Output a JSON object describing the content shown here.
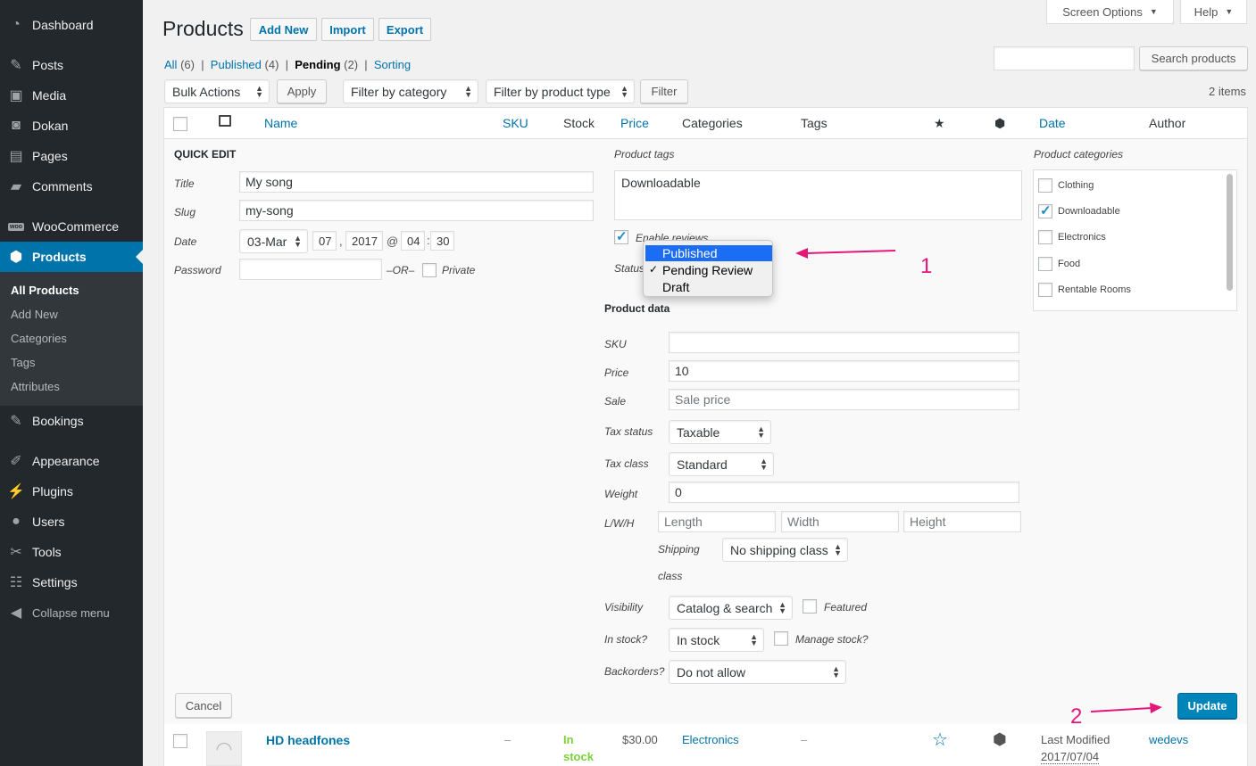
{
  "sidebar": {
    "items": [
      {
        "label": "Dashboard",
        "icon": "dashboard-icon"
      },
      {
        "label": "Posts",
        "icon": "pin-icon"
      },
      {
        "label": "Media",
        "icon": "media-icon"
      },
      {
        "label": "Dokan",
        "icon": "dokan-icon"
      },
      {
        "label": "Pages",
        "icon": "pages-icon"
      },
      {
        "label": "Comments",
        "icon": "comment-icon"
      },
      {
        "label": "WooCommerce",
        "icon": "woo-icon"
      },
      {
        "label": "Products",
        "icon": "products-icon"
      },
      {
        "label": "Bookings",
        "icon": "pin-icon"
      },
      {
        "label": "Appearance",
        "icon": "brush-icon"
      },
      {
        "label": "Plugins",
        "icon": "plugin-icon"
      },
      {
        "label": "Users",
        "icon": "user-icon"
      },
      {
        "label": "Tools",
        "icon": "wrench-icon"
      },
      {
        "label": "Settings",
        "icon": "settings-icon"
      },
      {
        "label": "Collapse menu",
        "icon": "collapse-icon"
      }
    ],
    "submenu": [
      "All Products",
      "Add New",
      "Categories",
      "Tags",
      "Attributes"
    ]
  },
  "header": {
    "title": "Products",
    "add_new": "Add New",
    "import": "Import",
    "export": "Export",
    "screen_options": "Screen Options",
    "help": "Help"
  },
  "views": {
    "all": "All",
    "all_count": "(6)",
    "published": "Published",
    "published_count": "(4)",
    "pending": "Pending",
    "pending_count": "(2)",
    "sorting": "Sorting"
  },
  "search": {
    "button": "Search products",
    "value": ""
  },
  "filters": {
    "bulk_actions": "Bulk Actions",
    "apply": "Apply",
    "category": "Filter by category",
    "product_type": "Filter by product type",
    "filter": "Filter",
    "items_count": "2 items"
  },
  "columns": [
    "Name",
    "SKU",
    "Stock",
    "Price",
    "Categories",
    "Tags",
    "Date",
    "Author"
  ],
  "quick_edit": {
    "heading": "QUICK EDIT",
    "title_label": "Title",
    "title_value": "My song",
    "slug_label": "Slug",
    "slug_value": "my-song",
    "date_label": "Date",
    "month": "03-Mar",
    "day": "07",
    "comma": ",",
    "year": "2017",
    "at": "@",
    "hour": "04",
    "colon": ":",
    "minute": "30",
    "password_label": "Password",
    "or": "–OR–",
    "private": "Private",
    "tags_label": "Product tags",
    "tags_value": "Downloadable",
    "enable_reviews": "Enable reviews",
    "status_label": "Status",
    "status_options": [
      "Published",
      "Pending Review",
      "Draft"
    ],
    "status_selected": "Pending Review",
    "categories_label": "Product categories",
    "categories": [
      {
        "name": "Clothing",
        "checked": false
      },
      {
        "name": "Downloadable",
        "checked": true
      },
      {
        "name": "Electronics",
        "checked": false
      },
      {
        "name": "Food",
        "checked": false
      },
      {
        "name": "Rentable Rooms",
        "checked": false
      }
    ],
    "product_data": "Product data",
    "sku_label": "SKU",
    "sku_value": "",
    "price_label": "Price",
    "price_value": "10",
    "sale_label": "Sale",
    "sale_placeholder": "Sale price",
    "tax_status_label": "Tax status",
    "tax_status": "Taxable",
    "tax_class_label": "Tax class",
    "tax_class": "Standard",
    "weight_label": "Weight",
    "weight_value": "0",
    "lwh_label": "L/W/H",
    "length": "Length",
    "width": "Width",
    "height": "Height",
    "shipping_label": "Shipping",
    "shipping_label2": "class",
    "shipping_class": "No shipping class",
    "visibility_label": "Visibility",
    "visibility": "Catalog & search",
    "featured": "Featured",
    "instock_label": "In stock?",
    "instock": "In stock",
    "manage_stock": "Manage stock?",
    "backorders_label": "Backorders?",
    "backorders": "Do not allow",
    "cancel": "Cancel",
    "update": "Update"
  },
  "annotations": {
    "one": "1",
    "two": "2"
  },
  "row": {
    "name": "HD headfones",
    "sku": "–",
    "stock1": "In",
    "stock2": "stock",
    "price": "$30.00",
    "category": "Electronics",
    "tags": "–",
    "date1": "Last Modified",
    "date2": "2017/07/04",
    "author": "wedevs"
  },
  "colors": {
    "accent": "#0073aa",
    "sidebar": "#23282d",
    "annotation": "#e5187a",
    "instock": "#7ad03a"
  }
}
